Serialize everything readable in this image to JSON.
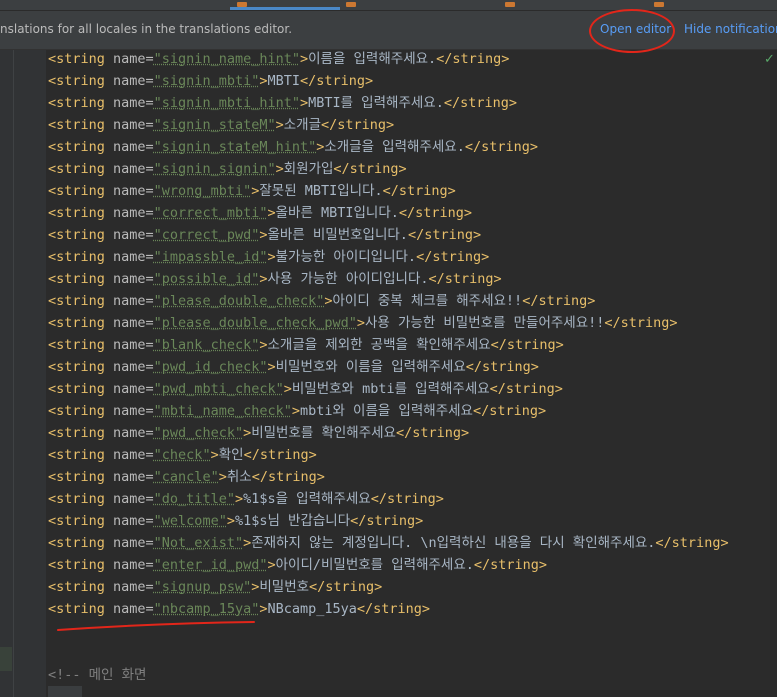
{
  "notification": {
    "text": "nslations for all locales in the translations editor.",
    "open_editor": "Open editor",
    "hide_notification": "Hide notification"
  },
  "code": {
    "lines": [
      {
        "name": "signin_name_hint",
        "text": "이름을 입력해주세요."
      },
      {
        "name": "signin_mbti",
        "text": "MBTI"
      },
      {
        "name": "signin_mbti_hint",
        "text": "MBTI를 입력해주세요."
      },
      {
        "name": "signin_stateM",
        "text": "소개글"
      },
      {
        "name": "signin_stateM_hint",
        "text": "소개글을 입력해주세요."
      },
      {
        "name": "signin_signin",
        "text": "회원가입"
      },
      {
        "name": "wrong_mbti",
        "text": "잘못된 MBTI입니다."
      },
      {
        "name": "correct_mbti",
        "text": "올바른 MBTI입니다."
      },
      {
        "name": "correct_pwd",
        "text": "올바른 비밀번호입니다."
      },
      {
        "name": "impassble_id",
        "text": "불가능한 아이디입니다."
      },
      {
        "name": "possible_id",
        "text": "사용 가능한 아이디입니다."
      },
      {
        "name": "please_double_check",
        "text": "아이디 중복 체크를 해주세요!!"
      },
      {
        "name": "please_double_check_pwd",
        "text": "사용 가능한 비밀번호를 만들어주세요!!"
      },
      {
        "name": "blank_check",
        "text": "소개글을 제외한 공백을 확인해주세요"
      },
      {
        "name": "pwd_id_check",
        "text": "비밀번호와 이름을 입력해주세요"
      },
      {
        "name": "pwd_mbti_check",
        "text": "비밀번호와 mbti를 입력해주세요"
      },
      {
        "name": "mbti_name_check",
        "text": "mbti와 이름을 입력해주세요"
      },
      {
        "name": "pwd_check",
        "text": "비밀번호를 확인해주세요"
      },
      {
        "name": "check",
        "text": "확인"
      },
      {
        "name": "cancle",
        "text": "취소"
      },
      {
        "name": "do_title",
        "text": "%1$s을 입력해주세요"
      },
      {
        "name": "welcome",
        "text": "%1$s님 반갑습니다"
      },
      {
        "name": "Not_exist",
        "text": "존재하지 않는 계정입니다. \\n입력하신 내용을 다시 확인해주세요."
      },
      {
        "name": "enter_id_pwd",
        "text": "아이디/비밀번호를 입력해주세요."
      },
      {
        "name": "signup_psw",
        "text": "비밀번호"
      },
      {
        "name": "nbcamp_15ya",
        "text": "NBcamp_15ya"
      }
    ],
    "comment": "<!-- 메인 화면"
  },
  "colors": {
    "annotation": "#e2261a",
    "link": "#589df6",
    "tag": "#e8bf6a",
    "string_value": "#6a8759"
  }
}
